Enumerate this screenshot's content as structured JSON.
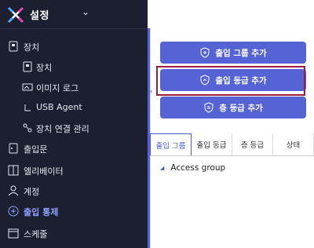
{
  "app": {
    "title": "설정"
  },
  "sidebar": {
    "items": [
      {
        "label": "장치",
        "icon": "device-icon"
      },
      {
        "label": "장치",
        "icon": "device-sub-icon"
      },
      {
        "label": "이미지 로그",
        "icon": "image-log-icon"
      },
      {
        "label": "USB Agent",
        "icon": "usb-icon"
      },
      {
        "label": "장치 연결 관리",
        "icon": "connection-icon"
      },
      {
        "label": "출입문",
        "icon": "door-icon"
      },
      {
        "label": "엘리베이터",
        "icon": "elevator-icon"
      },
      {
        "label": "계정",
        "icon": "user-icon"
      },
      {
        "label": "출입 통제",
        "icon": "access-control-icon",
        "active": true
      },
      {
        "label": "스케줄",
        "icon": "calendar-icon"
      }
    ]
  },
  "actions": {
    "add_group": "출입 그룹 추가",
    "add_level": "출입 등급 추가",
    "add_floor_level": "층 등급 추가"
  },
  "tabs": [
    "출입 그룹",
    "출입 등급",
    "층 등급",
    "상태"
  ],
  "tree": {
    "root_label": "Access group"
  },
  "colors": {
    "sidebar_bg": "#1c1f30",
    "accent": "#5563d4",
    "highlight": "#9b1f3a"
  }
}
